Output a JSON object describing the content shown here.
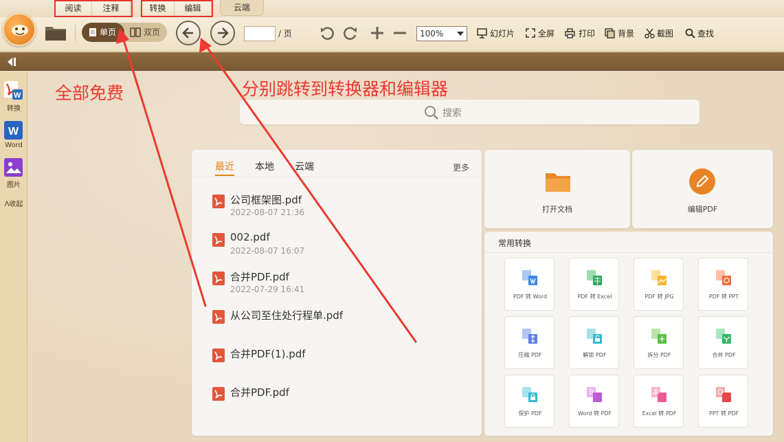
{
  "tabs": {
    "read": "阅读",
    "annotate": "注释",
    "convert": "转换",
    "edit": "编辑",
    "cloud": "云端"
  },
  "toolbar": {
    "single_page": "单页",
    "double_page": "双页",
    "page_input_value": "",
    "page_suffix": "/ 页",
    "zoom_value": "100%",
    "slideshow": "幻灯片",
    "fullscreen": "全屏",
    "print": "打印",
    "background": "背景",
    "screenshot": "截图",
    "find": "查找"
  },
  "sidebar": {
    "items": [
      {
        "label": "转换",
        "icon": "pdf-convert-icon"
      },
      {
        "label": "Word",
        "icon": "word-icon"
      },
      {
        "label": "图片",
        "icon": "image-icon"
      }
    ],
    "collapse_label": "收起"
  },
  "search": {
    "placeholder": "搜索"
  },
  "recent": {
    "tabs": [
      {
        "label": "最近",
        "active": true
      },
      {
        "label": "本地",
        "active": false
      },
      {
        "label": "云端",
        "active": false
      }
    ],
    "more": "更多",
    "files": [
      {
        "name": "公司框架图.pdf",
        "date": "2022-08-07 21:36"
      },
      {
        "name": "002.pdf",
        "date": "2022-08-07 16:07"
      },
      {
        "name": "合并PDF.pdf",
        "date": "2022-07-29 16:41"
      },
      {
        "name": "从公司至住处行程单.pdf",
        "date": ""
      },
      {
        "name": "合并PDF(1).pdf",
        "date": ""
      },
      {
        "name": "合并PDF.pdf",
        "date": ""
      }
    ]
  },
  "actions": {
    "open_doc": "打开文档",
    "edit_pdf": "编辑PDF"
  },
  "conversions": {
    "title": "常用转换",
    "tiles": [
      "PDF 转 Word",
      "PDF 转 Excel",
      "PDF 转 JPG",
      "PDF 转 PPT",
      "压缩 PDF",
      "解锁 PDF",
      "拆分 PDF",
      "合并 PDF",
      "保护 PDF",
      "Word 转 PDF",
      "Excel 转 PDF",
      "PPT 转 PDF"
    ]
  },
  "annotations": {
    "free_text": "全部免费",
    "jump_text": "分别跳转到转换器和编辑器"
  },
  "colors": {
    "accent": "#e0841b",
    "annotation_red": "#ec3a31",
    "toolbar_brown": "#7a5a33"
  }
}
